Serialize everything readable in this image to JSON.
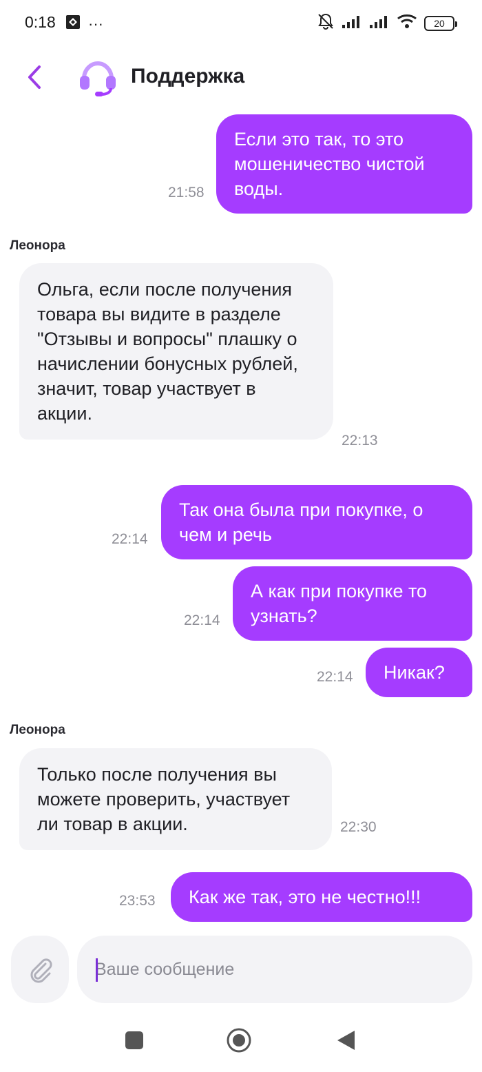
{
  "status_bar": {
    "time": "0:18",
    "more": "···",
    "battery": "20"
  },
  "header": {
    "title": "Поддержка",
    "back_icon": "chevron-left-icon",
    "avatar_icon": "headset-icon"
  },
  "messages": [
    {
      "direction": "out",
      "text": "Если это так, то это мошеничество чистой воды.",
      "time": "21:58"
    },
    {
      "direction": "in",
      "sender": "Леонора",
      "text": "Ольга, если после получения товара вы видите в разделе \"Отзывы и вопросы\" плашку о начислении бонусных рублей, значит, товар участвует в акции.",
      "time": "22:13"
    },
    {
      "direction": "out",
      "text": "Так она была при покупке, о чем и речь",
      "time": "22:14"
    },
    {
      "direction": "out",
      "text": "А как при покупке то узнать?",
      "time": "22:14"
    },
    {
      "direction": "out",
      "text": "Никак?",
      "time": "22:14"
    },
    {
      "direction": "in",
      "sender": "Леонора",
      "text": "Только после получения вы можете проверить, участвует ли товар в акции.",
      "time": "22:30"
    },
    {
      "direction": "out",
      "text": "Как же так, это не честно!!!",
      "time": "23:53"
    }
  ],
  "composer": {
    "placeholder": "Ваше сообщение",
    "attach_icon": "paperclip-icon"
  },
  "colors": {
    "accent": "#a53cff",
    "incoming_bubble": "#f3f3f6",
    "time_text": "#8e8e96"
  }
}
